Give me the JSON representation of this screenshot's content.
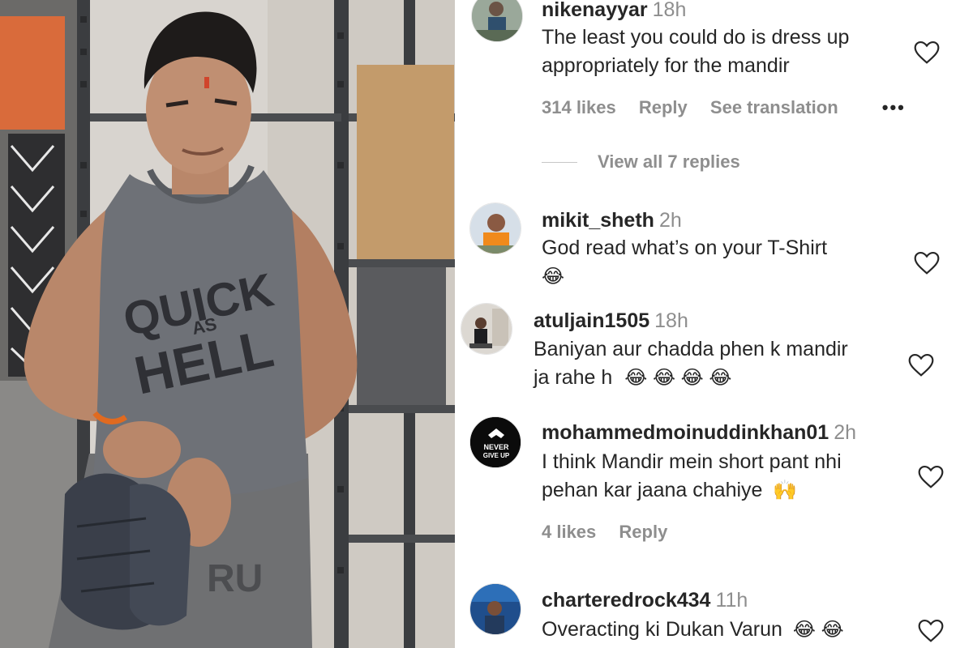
{
  "photo": {
    "shirt_text_1": "QUICK",
    "shirt_text_2": "AS",
    "shirt_text_3": "HELL",
    "shorts_text": "RU"
  },
  "comments": [
    {
      "username": "nikenayyar",
      "time": "18h",
      "lines": [
        "The least you could do is dress up",
        "appropriately for the mandir"
      ],
      "emojis": "",
      "likes": "314 likes",
      "reply": "Reply",
      "translate": "See translation",
      "more": "•••",
      "view_replies": "View all 7 replies"
    },
    {
      "username": "mikit_sheth",
      "time": "2h",
      "lines": [
        "God read what’s on your T-Shirt"
      ],
      "emojis": "😂"
    },
    {
      "username": "atuljain1505",
      "time": "18h",
      "lines": [
        "Baniyan aur chadda phen k mandir",
        "ja rahe h"
      ],
      "emojis": "😂 😂 😂 😂"
    },
    {
      "username": "mohammedmoinuddinkhan01",
      "time": "2h",
      "lines": [
        "I think Mandir mein short pant nhi",
        "pehan kar jaana chahiye"
      ],
      "emojis": "🙌",
      "likes": "4 likes",
      "reply": "Reply",
      "avatar_text_1": "NEVER",
      "avatar_text_2": "GIVE UP"
    },
    {
      "username": "charteredrock434",
      "time": "11h",
      "lines": [
        "Overacting ki Dukan Varun"
      ],
      "emojis": "😂 😂"
    }
  ],
  "colors": {
    "text": "#262626",
    "secondary": "#8e8e8e",
    "background": "#ffffff"
  },
  "icons": {
    "like": "heart-outline-icon",
    "more": "more-options-icon"
  }
}
